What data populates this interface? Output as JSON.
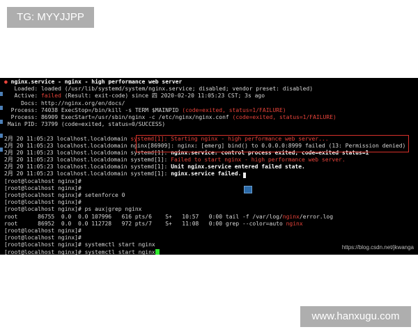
{
  "top_badge": "TG: MYYJJPP",
  "bottom_badge": "www.hanxugu.com",
  "watermark": "https://blog.csdn.net/jkwanga",
  "terminal": {
    "status": {
      "dot": "●",
      "service_line": "nginx.service - nginx - high performance web server",
      "loaded": "   Loaded: loaded (/usr/lib/systemd/system/nginx.service; disabled; vendor preset: disabled)",
      "active_prefix": "   Active: ",
      "active_state": "failed",
      "active_suffix": " (Result: exit-code) since 四 2020-02-20 11:05:23 CST; 3s ago",
      "docs": "     Docs: http://nginx.org/en/docs/",
      "process1_prefix": "  Process: 74038 ExecStop=/bin/kill -s TERM $MAINPID ",
      "process1_code": "(code=exited, status=1/FAILURE)",
      "process2_prefix": "  Process: 86909 ExecStart=/usr/sbin/nginx -c /etc/nginx/nginx.conf ",
      "process2_code": "(code=exited, status=1/FAILURE)",
      "mainpid": " Main PID: 73799 (code=exited, status=0/SUCCESS)"
    },
    "log_prefix": "2月 20 11:05:23 localhost.localdomain ",
    "log": [
      "systemd[1]: Starting nginx - high performance web server...",
      "nginx[86909]: nginx: [emerg] bind() to 0.0.0.0:8999 failed (13: Permission denied)",
      "systemd[1]: ",
      "nginx.service: control process exited, code=exited status=1",
      "systemd[1]: ",
      "Failed to start nginx - high performance web server.",
      "systemd[1]: ",
      "Unit nginx.service entered failed state.",
      "systemd[1]: ",
      "nginx.service failed."
    ],
    "prompt": "[root@localhost nginx]# ",
    "cmd_setenforce": "setenforce 0",
    "cmd_ps": "ps aux|grep nginx",
    "ps_row1_prefix": "root      86755  0.0  0.0 107996   616 pts/6    S+   10:57   0:00 tail -f /var/log/",
    "ps_row1_hl": "nginx",
    "ps_row1_suffix": "/error.log",
    "ps_row2_prefix": "root      86952  0.0  0.0 112728   972 pts/7    S+   11:08   0:00 grep --color=auto ",
    "ps_row2_hl": "nginx",
    "cmd_start": "systemctl start nginx",
    "colors": {
      "terminal_bg": "#000000",
      "error_red": "#e8433a",
      "cursor_green": "#2ee82e",
      "badge_grey": "#aeaeae"
    }
  }
}
